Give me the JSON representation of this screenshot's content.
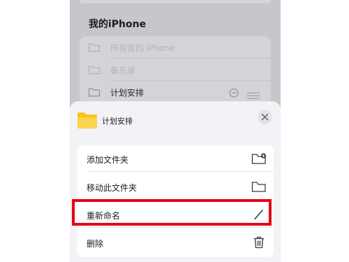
{
  "section_title": "我的iPhone",
  "folders": [
    {
      "label": "所有我的 iPhone"
    },
    {
      "label": "备忘录"
    },
    {
      "label": "计划安排"
    }
  ],
  "sheet": {
    "title": "计划安排",
    "folder_icon_color": "#f5c518",
    "actions": [
      {
        "label": "添加文件夹",
        "icon": "folder-plus-icon"
      },
      {
        "label": "移动此文件夹",
        "icon": "folder-icon"
      },
      {
        "label": "重新命名",
        "icon": "pencil-icon"
      },
      {
        "label": "删除",
        "icon": "trash-icon"
      }
    ]
  },
  "highlight_color": "#e30613"
}
